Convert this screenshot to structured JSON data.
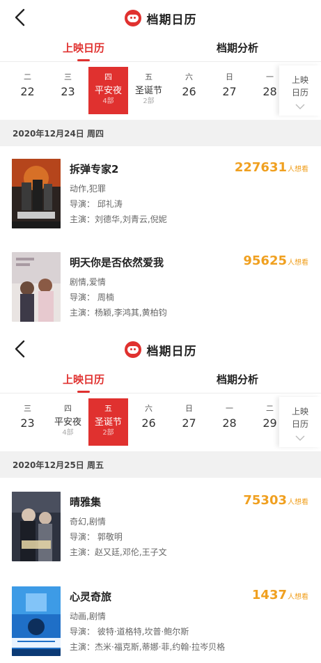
{
  "screens": [
    {
      "header": {
        "title": "档期日历"
      },
      "tabs": [
        "上映日历",
        "档期分析"
      ],
      "dates": [
        {
          "weekday": "二",
          "day": "22"
        },
        {
          "weekday": "三",
          "day": "23"
        },
        {
          "weekday": "四",
          "holiday": "平安夜",
          "count": "4部",
          "selected": true
        },
        {
          "weekday": "五",
          "holiday": "圣诞节",
          "count": "2部"
        },
        {
          "weekday": "六",
          "day": "26"
        },
        {
          "weekday": "日",
          "day": "27"
        },
        {
          "weekday": "一",
          "day": "28"
        }
      ],
      "more_label": "上映日历",
      "section_date": "2020年12月24日 周四",
      "movies": [
        {
          "title": "拆弹专家2",
          "want_count": "227631",
          "want_suffix": "人想看",
          "genre": "动作,犯罪",
          "director": "导演： 邱礼涛",
          "cast": "主演：刘德华,刘青云,倪妮"
        },
        {
          "title": "明天你是否依然爱我",
          "want_count": "95625",
          "want_suffix": "人想看",
          "genre": "剧情,爱情",
          "director": "导演： 周楠",
          "cast": "主演：杨颖,李鸿其,黄柏钧"
        }
      ]
    },
    {
      "header": {
        "title": "档期日历"
      },
      "tabs": [
        "上映日历",
        "档期分析"
      ],
      "dates": [
        {
          "weekday": "三",
          "day": "23"
        },
        {
          "weekday": "四",
          "holiday": "平安夜",
          "count": "4部"
        },
        {
          "weekday": "五",
          "holiday": "圣诞节",
          "count": "2部",
          "selected": true
        },
        {
          "weekday": "六",
          "day": "26"
        },
        {
          "weekday": "日",
          "day": "27"
        },
        {
          "weekday": "一",
          "day": "28"
        },
        {
          "weekday": "二",
          "day": "29"
        }
      ],
      "more_label": "上映日历",
      "section_date": "2020年12月25日 周五",
      "movies": [
        {
          "title": "晴雅集",
          "want_count": "75303",
          "want_suffix": "人想看",
          "genre": "奇幻,剧情",
          "director": "导演： 郭敬明",
          "cast": "主演：赵又廷,邓伦,王子文"
        },
        {
          "title": "心灵奇旅",
          "want_count": "1437",
          "want_suffix": "人想看",
          "genre": "动画,剧情",
          "director": "导演： 彼特·道格特,坎普·鲍尔斯",
          "cast": "主演：杰米·福克斯,蒂娜·菲,约翰·拉岑贝格"
        }
      ]
    }
  ],
  "colors": {
    "accent": "#e0312f",
    "want": "#f0a020",
    "section_bg": "#f1f1f1"
  }
}
